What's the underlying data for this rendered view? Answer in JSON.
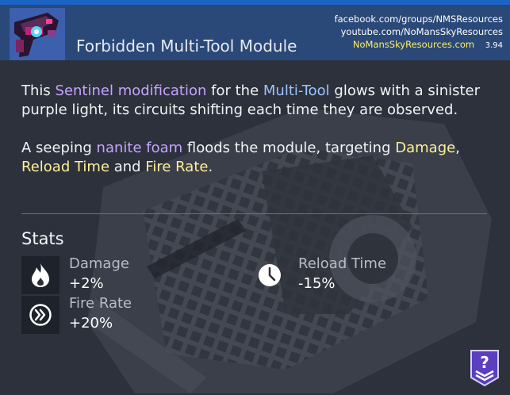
{
  "header": {
    "title": "Forbidden Multi-Tool Module",
    "links": [
      "facebook.com/groups/NMSResources",
      "youtube.com/NoMansSkyResources",
      "NoMansSkyResources.com"
    ],
    "version": "3.94",
    "accent_color": "#2a4878"
  },
  "description": {
    "p1": {
      "t1": "This ",
      "h1": "Sentinel modification",
      "t2": " for the ",
      "h2": "Multi-Tool",
      "t3": " glows with a sinister purple light, its circuits shifting each time they are observed."
    },
    "p2": {
      "t1": "A seeping ",
      "h1": "nanite foam",
      "t2": " floods the module, targeting ",
      "h2": "Damage",
      "t3": ",",
      "h3": "Reload Time",
      "t4": " and ",
      "h4": "Fire Rate",
      "t5": "."
    }
  },
  "stats": {
    "heading": "Stats",
    "items": [
      {
        "name": "Damage",
        "value": "+2%",
        "icon": "flame-icon"
      },
      {
        "name": "Reload Time",
        "value": "-15%",
        "icon": "clock-icon"
      },
      {
        "name": "Fire Rate",
        "value": "+20%",
        "icon": "double-chevron-icon"
      }
    ]
  },
  "badge": {
    "icon": "class-badge-icon",
    "color": "#5a3fc0"
  }
}
